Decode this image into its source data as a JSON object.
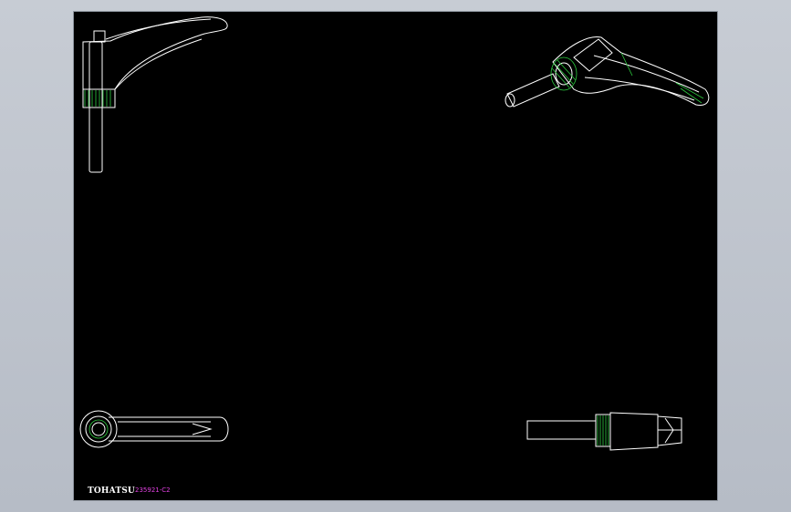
{
  "drawing": {
    "logo_text": "TOHATSU",
    "part_code": "235921-C2",
    "colors": {
      "background": "#000000",
      "line": "#ffffff",
      "thread": "#2ecc40",
      "code": "#e040e0",
      "frame": "#c7ccd4"
    }
  },
  "views": [
    {
      "name": "side-view"
    },
    {
      "name": "isometric-view"
    },
    {
      "name": "top-view"
    },
    {
      "name": "end-view"
    }
  ]
}
